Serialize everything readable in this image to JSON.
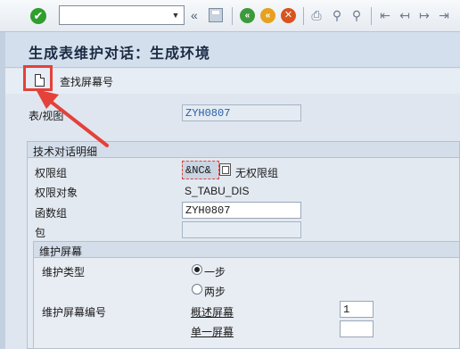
{
  "toolbar": {
    "command_field_value": "",
    "icons": [
      "check-icon",
      "history-icon",
      "save-icon",
      "back-icon",
      "exit-icon",
      "cancel-icon",
      "print-icon",
      "find-icon",
      "find-next-icon",
      "first-page-icon",
      "prev-page-icon",
      "next-page-icon",
      "last-page-icon"
    ]
  },
  "title": "生成表维护对话：生成环境",
  "app_toolbar": {
    "find_screen_label": "查找屏幕号"
  },
  "table_view": {
    "label": "表/视图",
    "value": "ZYH0807"
  },
  "tech_details": {
    "section_title": "技术对话明细",
    "auth_group_label": "权限组",
    "auth_group_value": "&NC&",
    "auth_group_text": "无权限组",
    "auth_object_label": "权限对象",
    "auth_object_value": "S_TABU_DIS",
    "function_group_label": "函数组",
    "function_group_value": "ZYH0807",
    "package_label": "包",
    "package_value": ""
  },
  "maintenance": {
    "section_title": "维护屏幕",
    "type_label": "维护类型",
    "option_one": "一步",
    "option_two": "两步",
    "selected": "一步",
    "screen_no_label": "维护屏幕编号",
    "overview_label": "概述屏幕",
    "overview_value": "1",
    "single_label": "单一屏幕",
    "single_value": ""
  },
  "colors": {
    "annotation": "#e4413a",
    "title_bg": "#d3dfec",
    "readonly_text": "#2a5ea8"
  }
}
